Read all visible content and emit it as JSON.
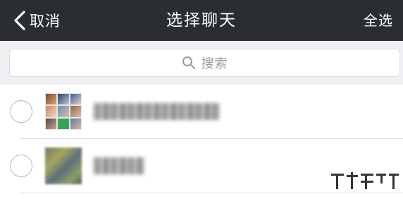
{
  "navbar": {
    "back_label": "取消",
    "title": "选择聊天",
    "select_all_label": "全选"
  },
  "search": {
    "placeholder": "搜索",
    "icon": "search-icon"
  },
  "chats": [
    {
      "name": "",
      "avatar": "group-avatar-grid",
      "selected": false
    },
    {
      "name": "",
      "avatar": "contact-avatar",
      "selected": false
    }
  ],
  "colors": {
    "navbar_bg": "#2b2e31",
    "search_area_bg": "#efeff4"
  }
}
